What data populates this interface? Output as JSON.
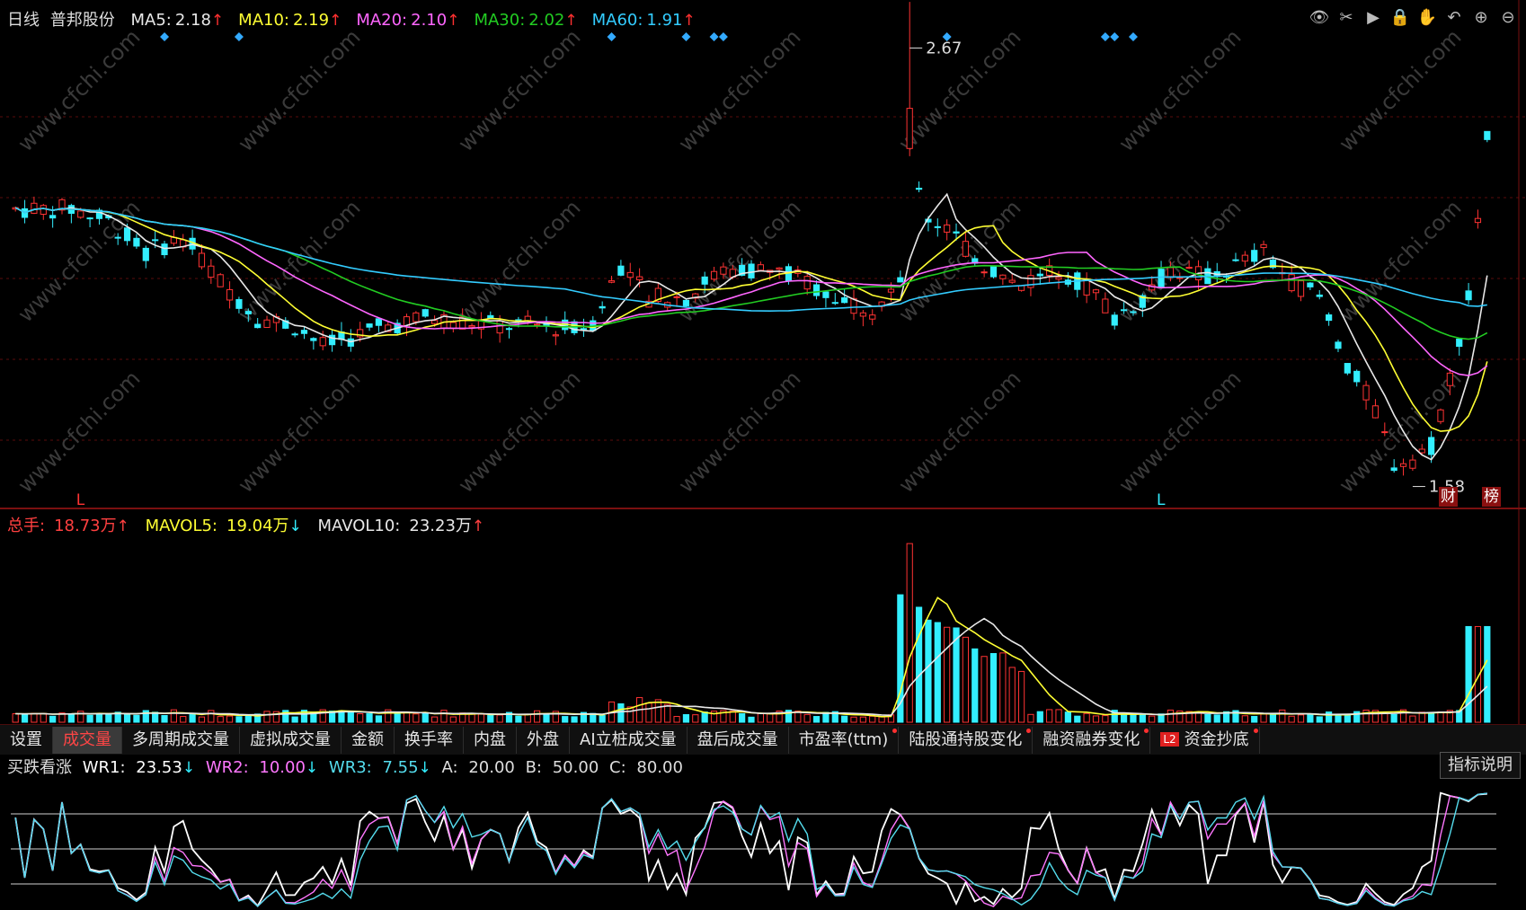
{
  "header": {
    "period": "日线",
    "stock_name": "普邦股份",
    "ma": [
      {
        "label": "MA5:",
        "value": "2.18",
        "arrow": "↑",
        "color": "#e8e8e8"
      },
      {
        "label": "MA10:",
        "value": "2.19",
        "arrow": "↑",
        "color": "#ffff33"
      },
      {
        "label": "MA20:",
        "value": "2.10",
        "arrow": "↑",
        "color": "#ff66ff"
      },
      {
        "label": "MA30:",
        "value": "2.02",
        "arrow": "↑",
        "color": "#22cc22"
      },
      {
        "label": "MA60:",
        "value": "1.91",
        "arrow": "↑",
        "color": "#33ccff"
      }
    ]
  },
  "toolbar_icons": [
    "eye-icon",
    "scissors-icon",
    "play-icon",
    "lock-icon",
    "hand-icon",
    "undo-icon",
    "zoom-in-icon",
    "zoom-out-icon"
  ],
  "toolbar_glyphs": [
    "👁",
    "✂",
    "▶",
    "🔒",
    "✋",
    "↶",
    "⊕",
    "⊖"
  ],
  "price_chart": {
    "high_label": "2.67",
    "low_label": "1.58",
    "markers": [
      "L",
      "L"
    ],
    "tag_cai": "财",
    "tag_bang": "榜",
    "watermark": "www.cfchi.com"
  },
  "volume": {
    "total_label": "总手:",
    "total_value": "18.73万",
    "total_arrow": "↑",
    "mavol5_label": "MAVOL5:",
    "mavol5_value": "19.04万",
    "mavol5_arrow": "↓",
    "mavol10_label": "MAVOL10:",
    "mavol10_value": "23.23万",
    "mavol10_arrow": "↑"
  },
  "tabs": [
    {
      "label": "设置",
      "active": false,
      "dot": false,
      "l2": false
    },
    {
      "label": "成交量",
      "active": true,
      "dot": false,
      "l2": false
    },
    {
      "label": "多周期成交量",
      "active": false,
      "dot": false,
      "l2": false
    },
    {
      "label": "虚拟成交量",
      "active": false,
      "dot": false,
      "l2": false
    },
    {
      "label": "金额",
      "active": false,
      "dot": false,
      "l2": false
    },
    {
      "label": "换手率",
      "active": false,
      "dot": false,
      "l2": false
    },
    {
      "label": "内盘",
      "active": false,
      "dot": false,
      "l2": false
    },
    {
      "label": "外盘",
      "active": false,
      "dot": false,
      "l2": false
    },
    {
      "label": "AI立桩成交量",
      "active": false,
      "dot": false,
      "l2": false
    },
    {
      "label": "盘后成交量",
      "active": false,
      "dot": false,
      "l2": false
    },
    {
      "label": "市盈率(ttm)",
      "active": false,
      "dot": true,
      "l2": false
    },
    {
      "label": "陆股通持股变化",
      "active": false,
      "dot": true,
      "l2": false
    },
    {
      "label": "融资融券变化",
      "active": false,
      "dot": true,
      "l2": false
    },
    {
      "label": "资金抄底",
      "active": false,
      "dot": true,
      "l2": true,
      "l2_text": "L2"
    }
  ],
  "wr": {
    "name": "买跌看涨",
    "wr1_label": "WR1:",
    "wr1_value": "23.53",
    "wr1_arrow": "↓",
    "wr2_label": "WR2:",
    "wr2_value": "10.00",
    "wr2_arrow": "↓",
    "wr3_label": "WR3:",
    "wr3_value": "7.55",
    "wr3_arrow": "↓",
    "a_label": "A:",
    "a_value": "20.00",
    "b_label": "B:",
    "b_value": "50.00",
    "c_label": "C:",
    "c_value": "80.00",
    "help_label": "指标说明"
  },
  "colors": {
    "up": "#ff3333",
    "down": "#33eeff",
    "ma5": "#e8e8e8",
    "ma10": "#ffff33",
    "ma20": "#ff66ff",
    "ma30": "#22cc22",
    "ma60": "#33ccff",
    "grid": "#5a0d0d",
    "wr1": "#ffffff",
    "wr2": "#ff77ff",
    "wr3": "#55ddee"
  }
}
